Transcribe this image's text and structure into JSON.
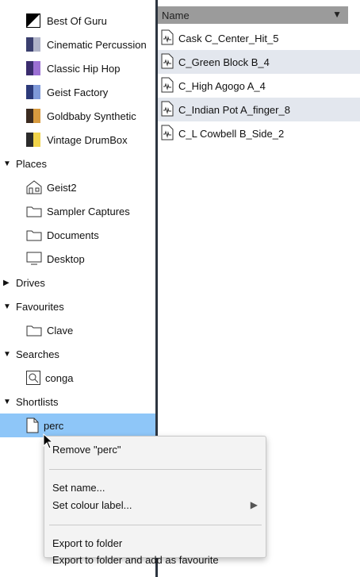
{
  "kits": [
    {
      "label": "Best Of Guru",
      "colors": [
        "#000000",
        "#ffffff"
      ]
    },
    {
      "label": "Cinematic Percussion",
      "colors": [
        "#3a3f6e",
        "#b0b4c8"
      ]
    },
    {
      "label": "Classic Hip Hop",
      "colors": [
        "#3a2c6e",
        "#9b6fd3"
      ]
    },
    {
      "label": "Geist Factory",
      "colors": [
        "#2c3a7a",
        "#7f99d8"
      ]
    },
    {
      "label": "Goldbaby Synthetic",
      "colors": [
        "#3b2b20",
        "#d79a3f"
      ]
    },
    {
      "label": "Vintage DrumBox",
      "colors": [
        "#2b2b2b",
        "#f0d34a"
      ]
    }
  ],
  "sections": {
    "places": "Places",
    "drives": "Drives",
    "favourites": "Favourites",
    "searches": "Searches",
    "shortlists": "Shortlists"
  },
  "places": [
    "Geist2",
    "Sampler Captures",
    "Documents",
    "Desktop"
  ],
  "favourites": [
    "Clave"
  ],
  "searches": [
    "conga"
  ],
  "shortlists": [
    "perc"
  ],
  "file_list": {
    "header": "Name",
    "files": [
      "Cask C_Center_Hit_5",
      "C_Green Block B_4",
      "C_High Agogo A_4",
      "C_Indian Pot A_finger_8",
      "C_L Cowbell B_Side_2"
    ]
  },
  "context_menu": {
    "remove": "Remove \"perc\"",
    "set_name": "Set name...",
    "set_colour": "Set colour label...",
    "export": "Export to folder",
    "export_fav": "Export to folder and add as favourite"
  },
  "colors": {
    "selection": "#8ec6f8",
    "divider": "#2d3540",
    "header": "#9b9b9b",
    "alt_row": "#e3e7ee"
  }
}
